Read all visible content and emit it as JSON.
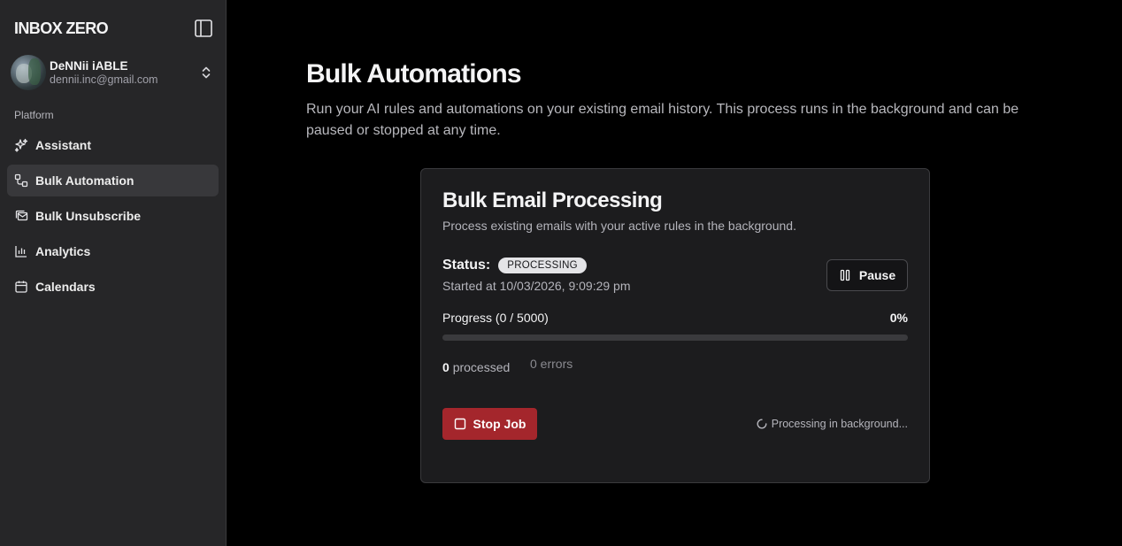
{
  "app": {
    "brand": "INBOX ZERO"
  },
  "user": {
    "name": "DeNNii iABLE",
    "email": "dennii.inc@gmail.com"
  },
  "sidebar": {
    "section_label": "Platform",
    "items": [
      {
        "label": "Assistant",
        "icon": "sparkles-icon",
        "active": false
      },
      {
        "label": "Bulk Automation",
        "icon": "workflow-icon",
        "active": true
      },
      {
        "label": "Bulk Unsubscribe",
        "icon": "mail-stack-icon",
        "active": false
      },
      {
        "label": "Analytics",
        "icon": "bar-chart-icon",
        "active": false
      },
      {
        "label": "Calendars",
        "icon": "calendar-icon",
        "active": false
      }
    ]
  },
  "main": {
    "title": "Bulk Automations",
    "description": "Run your AI rules and automations on your existing email history. This process runs in the background and can be paused or stopped at any time."
  },
  "card": {
    "title": "Bulk Email Processing",
    "description": "Process existing emails with your active rules in the background.",
    "status_label": "Status:",
    "status_badge": "PROCESSING",
    "started_at": "Started at 10/03/2026, 9:09:29 pm",
    "pause_label": "Pause",
    "progress_label": "Progress (0 / 5000)",
    "progress_percent": "0%",
    "progress_value": 0,
    "processed_count": "0",
    "processed_label": "processed",
    "errors_label": "0 errors",
    "stop_label": "Stop Job",
    "background_status": "Processing in background..."
  },
  "colors": {
    "sidebar_bg": "#262628",
    "main_bg": "#000000",
    "card_bg": "#1c1c1e",
    "stop_button": "#a4262c",
    "badge_bg": "#e4e4e7"
  }
}
